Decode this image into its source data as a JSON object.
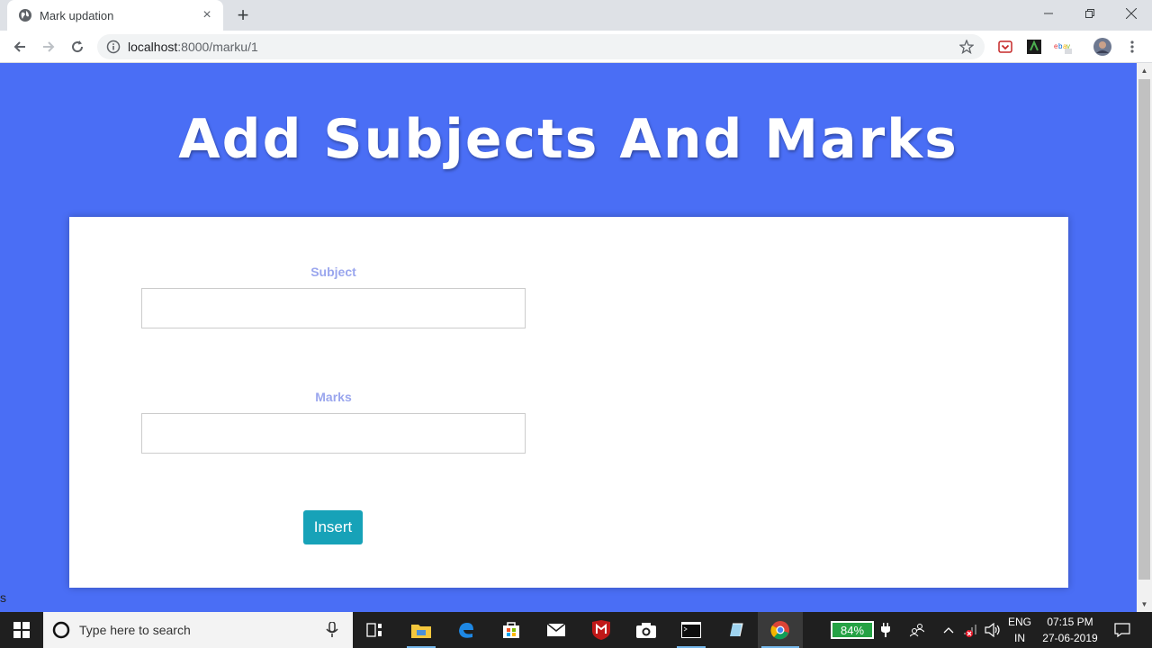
{
  "browser": {
    "tab_title": "Mark updation",
    "tab_close": "×",
    "new_tab": "+",
    "url_host": "localhost",
    "url_path": ":8000/marku/1"
  },
  "page": {
    "heading": "Add Subjects And Marks",
    "subject_label": "Subject",
    "subject_value": "",
    "marks_label": "Marks",
    "marks_value": "",
    "insert_label": "Insert",
    "status_text": "s"
  },
  "taskbar": {
    "search_placeholder": "Type here to search",
    "battery": "84%",
    "lang_top": "ENG",
    "lang_bottom": "IN",
    "time": "07:15 PM",
    "date": "27-06-2019"
  },
  "colors": {
    "page_bg": "#4a6ef5",
    "button": "#17a2b8",
    "label": "#9aa6ee"
  }
}
